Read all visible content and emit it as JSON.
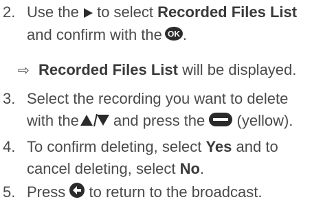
{
  "steps": [
    {
      "num": "2.",
      "part1": "Use the",
      "part2": "to select",
      "bold1": "Recorded Files List",
      "line2a": "and confirm with the",
      "line2b": "."
    },
    {
      "num": "3.",
      "line1": "Select the recording you want to delete",
      "line2a": "with the",
      "line2b": "and press the",
      "line2c": "(yellow)."
    },
    {
      "num": "4.",
      "line1a": "To confirm deleting, select",
      "bold1": "Yes",
      "line1b": "and to",
      "line2a": "cancel deleting, select",
      "bold2": "No",
      "line2b": "."
    },
    {
      "num": "5.",
      "part1": "Press",
      "part2": "to return to the broadcast."
    }
  ],
  "result": {
    "arrow": "⇨",
    "bold": "Recorded Files List",
    "text": "will be displayed."
  },
  "icons": {
    "right": "right-arrow-icon",
    "ok": "ok-button-icon",
    "updown": "up-down-arrow-icon",
    "yellow": "yellow-button-icon",
    "back": "back-button-icon"
  }
}
